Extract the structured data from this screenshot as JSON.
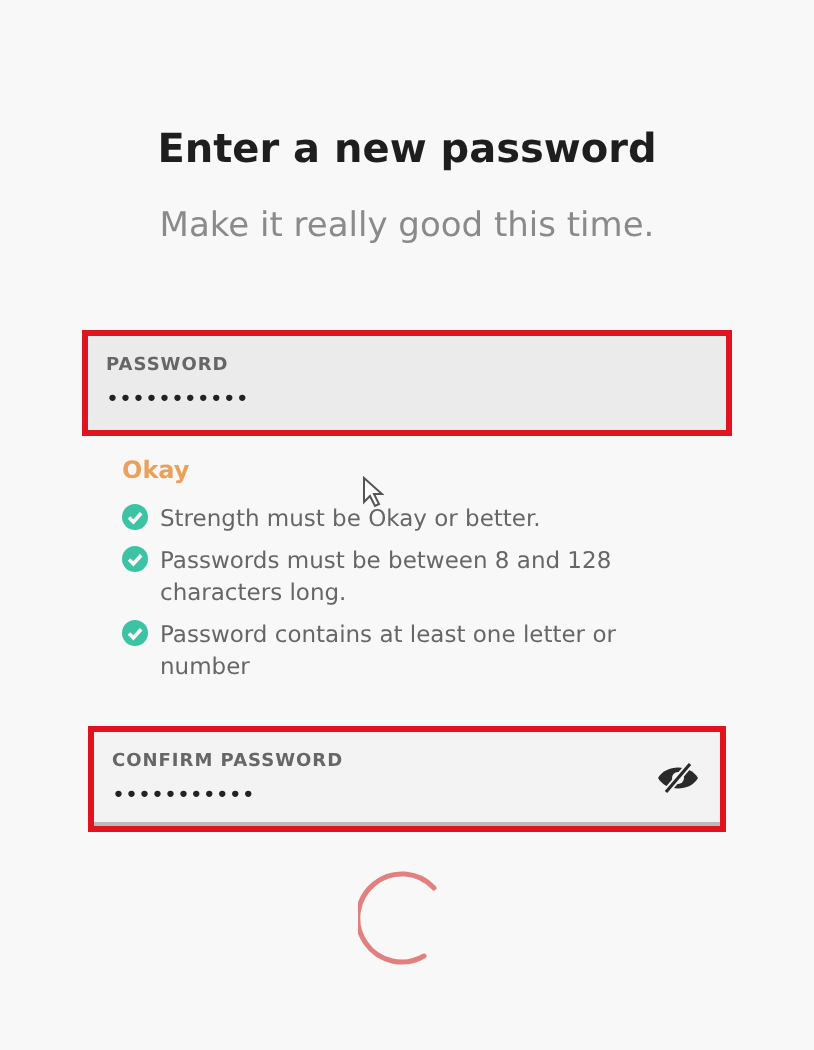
{
  "heading": "Enter a new password",
  "subheading": "Make it really good this time.",
  "password_field": {
    "label": "PASSWORD",
    "value": "•••••••••••",
    "highlighted": true
  },
  "strength": {
    "label": "Okay",
    "color": "#e9a15c"
  },
  "requirements": [
    {
      "text": "Strength must be Okay or better.",
      "met": true
    },
    {
      "text": "Passwords must be between 8 and 128 characters long.",
      "met": true
    },
    {
      "text": "Password contains at least one letter or number",
      "met": true
    }
  ],
  "confirm_field": {
    "label": "CONFIRM PASSWORD",
    "value": "•••••••••••",
    "highlighted": true,
    "reveal_icon": true
  },
  "loading": true
}
